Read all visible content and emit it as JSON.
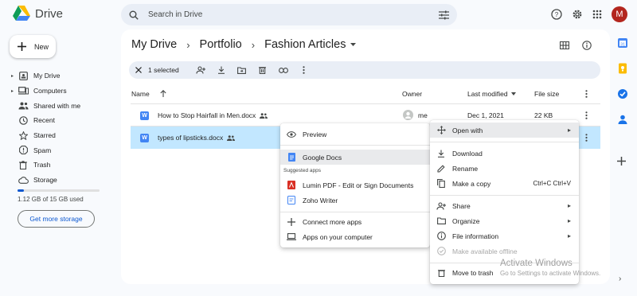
{
  "app": {
    "name": "Drive",
    "avatar_initial": "M"
  },
  "search": {
    "placeholder": "Search in Drive"
  },
  "nav": {
    "new_label": "New",
    "items": [
      {
        "label": "My Drive"
      },
      {
        "label": "Computers"
      },
      {
        "label": "Shared with me"
      },
      {
        "label": "Recent"
      },
      {
        "label": "Starred"
      },
      {
        "label": "Spam"
      },
      {
        "label": "Trash"
      },
      {
        "label": "Storage"
      }
    ],
    "storage_text": "1.12 GB of 15 GB used",
    "storage_used_fraction": 0.075,
    "get_storage_label": "Get more storage"
  },
  "breadcrumb": {
    "items": [
      "My Drive",
      "Portfolio",
      "Fashion Articles"
    ]
  },
  "selection": {
    "text": "1 selected"
  },
  "table": {
    "columns": {
      "name": "Name",
      "owner": "Owner",
      "modified": "Last modified",
      "size": "File size"
    },
    "rows": [
      {
        "name": "How to Stop Hairfall in Men.docx",
        "owner": "me",
        "modified": "Dec 1, 2021",
        "size": "22 KB"
      },
      {
        "name": "types of lipsticks.docx"
      }
    ]
  },
  "open_with_menu": {
    "preview": "Preview",
    "google_docs": "Google Docs",
    "suggested_heading": "Suggested apps",
    "lumin": "Lumin PDF - Edit or Sign Documents",
    "zoho": "Zoho Writer",
    "connect": "Connect more apps",
    "computer": "Apps on your computer"
  },
  "context_menu": {
    "open_with": "Open with",
    "download": "Download",
    "rename": "Rename",
    "make_copy": "Make a copy",
    "make_copy_shortcut": "Ctrl+C Ctrl+V",
    "share": "Share",
    "organize": "Organize",
    "file_info": "File information",
    "offline": "Make available offline",
    "trash": "Move to trash"
  },
  "watermark": {
    "line1": "Activate Windows",
    "line2": "Go to Settings to activate Windows."
  },
  "colors": {
    "accent": "#0b57d0",
    "selected_row": "#c2e7ff",
    "avatar": "#b3261e"
  }
}
